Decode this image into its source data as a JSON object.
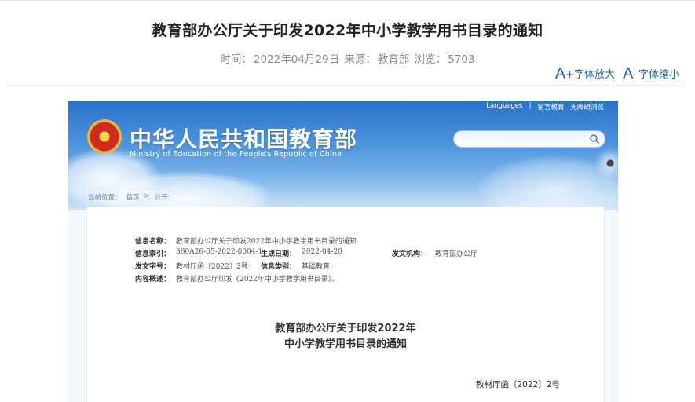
{
  "article": {
    "title": "教育部办公厅关于印发2022年中小学教学用书目录的通知",
    "meta_time_label": "时间：",
    "meta_time": "2022年04月29日",
    "meta_source_label": "来源：",
    "meta_source": "教育部",
    "meta_views_label": "浏览：",
    "meta_views": "5703"
  },
  "font_tools": {
    "enlarge_a": "A",
    "enlarge_label": "+字体放大",
    "shrink_a": "A",
    "shrink_label": "–字体缩小"
  },
  "doc": {
    "toplinks": [
      "Languages",
      "|",
      "留言教育",
      "无障碍浏览"
    ],
    "site_name": "中华人民共和国教育部",
    "site_en": "Ministry of Education of the People's Republic of China",
    "breadcrumb": [
      "当前位置：",
      "首页",
      ">",
      "公开"
    ],
    "info": {
      "name_label": "信息名称：",
      "name_value": "教育部办公厅关于印发2022年中小学教学用书目录的通知",
      "index_label": "信息索引：",
      "index_value": "360A26-05-2022-0004-1",
      "date_label": "生成日期：",
      "date_value": "2022-04-20",
      "org_label": "发文机构：",
      "org_value": "教育部办公厅",
      "docno_label": "发文字号：",
      "docno_value": "教材厅函〔2022〕2号",
      "cat_label": "信息类别：",
      "cat_value": "基础教育",
      "summary_label": "内容概述：",
      "summary_value": "教育部办公厅印发《2022年中小学教学用书目录》。"
    },
    "title_line1": "教育部办公厅关于印发2022年",
    "title_line2": "中小学教学用书目录的通知",
    "doc_number": "教材厅函〔2022〕2号"
  }
}
